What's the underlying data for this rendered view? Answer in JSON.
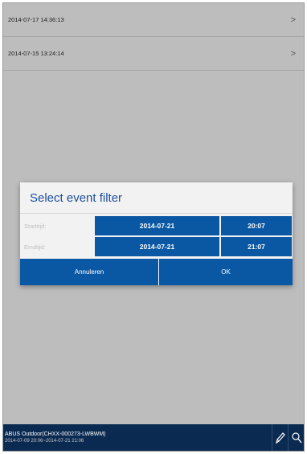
{
  "events": [
    {
      "timestamp": "2014-07-17 14:36:13",
      "chevron": ">"
    },
    {
      "timestamp": "2014-07-15 13:24:14",
      "chevron": ">"
    }
  ],
  "dialog": {
    "title": "Select event filter",
    "start_label": "Starttijd:",
    "start_date": "2014-07-21",
    "start_time": "20:07",
    "end_label": "Eindtijd:",
    "end_date": "2014-07-21",
    "end_time": "21:07",
    "cancel_label": "Annuleren",
    "ok_label": "OK"
  },
  "bottom_bar": {
    "camera_name": "ABUS Outdoor(CHXX-000273-LWBWM)",
    "time_range": "2014-07-09 20:06~2014-07-21 21:06",
    "edit_icon": "pencil-icon",
    "search_icon": "search-icon"
  },
  "colors": {
    "background": "#bdbdbd",
    "accent_blue": "#0a57a4",
    "title_blue": "#1e4f9a",
    "bottom_bar": "#0b2a52"
  }
}
